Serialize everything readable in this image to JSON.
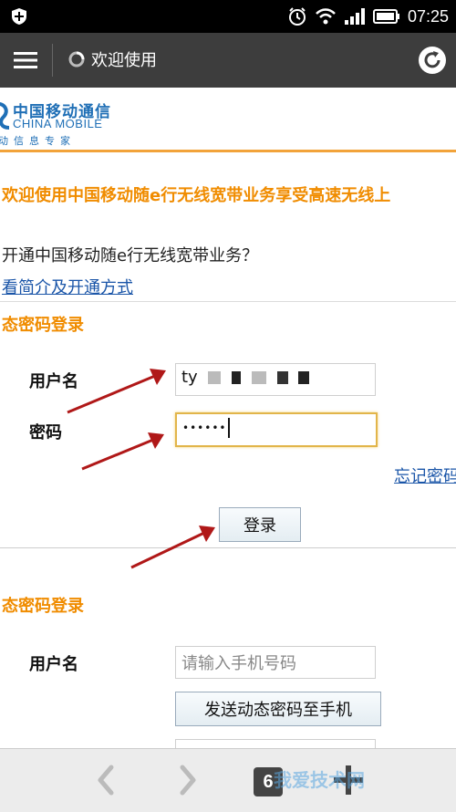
{
  "status_bar": {
    "time": "07:25"
  },
  "app_bar": {
    "title": "欢迎使用"
  },
  "logo": {
    "chinese": "中国移动通信",
    "english": "CHINA MOBILE",
    "slogan": "动信息专家"
  },
  "page": {
    "welcome": "欢迎使用中国移动随e行无线宽带业务享受高速无线上",
    "question": "开通中国移动随e行无线宽带业务？",
    "intro_link": "看简介及开通方式"
  },
  "static_login": {
    "title": "态密码登录",
    "username_label": "用户名",
    "username_value": "ty",
    "password_label": "密码",
    "password_value": "••••••",
    "forgot_link": "忘记密码",
    "login_button": "登录"
  },
  "dynamic_login": {
    "title": "态密码登录",
    "username_label": "用户名",
    "phone_placeholder": "请输入手机号码",
    "send_button": "发送动态密码至手机"
  },
  "bottom_bar": {
    "tab_count": "6",
    "watermark": "我爱技术网"
  },
  "colors": {
    "accent": "#f08c00",
    "link": "#1a55a8",
    "brand": "#1f6fb6"
  }
}
